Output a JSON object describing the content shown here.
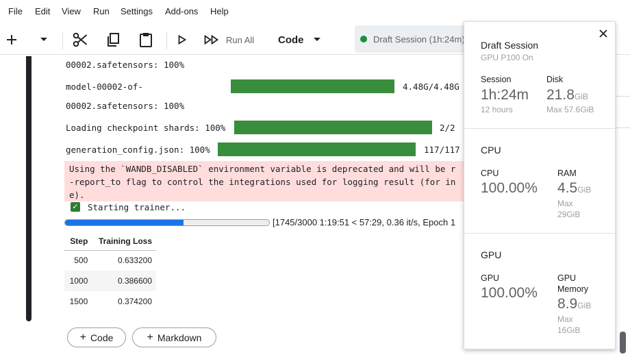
{
  "menu": [
    "File",
    "Edit",
    "View",
    "Run",
    "Settings",
    "Add-ons",
    "Help"
  ],
  "toolbar": {
    "run_all_label": "Run All",
    "cell_type": "Code",
    "icons": [
      "plus-icon",
      "chevron-down-icon",
      "scissors-icon",
      "copy-icon",
      "clipboard-icon",
      "play-icon",
      "fast-forward-icon"
    ]
  },
  "session_pill": {
    "label": "Draft Session (1h:24m)",
    "status_color": "#1e8e3e"
  },
  "output": {
    "line1": "00002.safetensors: 100%",
    "model_label": "model-00002-of-",
    "model_size": "4.48G/4.48G",
    "line3": "00002.safetensors: 100%",
    "checkpoint_label": "Loading checkpoint shards: 100%",
    "checkpoint_count": "2/2",
    "genconfig_label": "generation_config.json: 100%",
    "genconfig_count": "117/117",
    "warning_lines": [
      "Using the `WANDB_DISABLED` environment variable is deprecated and will be r",
      "-report_to flag to control the integrations used for logging result (for in",
      "e)."
    ],
    "trainer_status": "Starting trainer...",
    "progress_fraction": 0.582,
    "progress_text": "[1745/3000 1:19:51 < 57:29, 0.36 it/s, Epoch 1",
    "bar_color": "#388e3c",
    "progress_color": "#1a73e8"
  },
  "loss_table": {
    "headers": [
      "Step",
      "Training Loss"
    ],
    "rows": [
      [
        "500",
        "0.633200"
      ],
      [
        "1000",
        "0.386600"
      ],
      [
        "1500",
        "0.374200"
      ]
    ]
  },
  "add_buttons": {
    "code": "Code",
    "markdown": "Markdown"
  },
  "panel": {
    "title": "Draft Session",
    "subtitle": "GPU P100 On",
    "session_label": "Session",
    "session_value": "1h:24m",
    "session_max": "12 hours",
    "disk_label": "Disk",
    "disk_value": "21.8",
    "disk_unit": "GiB",
    "disk_max": "Max 57.6GiB",
    "cpu_section": "CPU",
    "cpu_label": "CPU",
    "cpu_value": "100.00%",
    "ram_label": "RAM",
    "ram_value": "4.5",
    "ram_unit": "GiB",
    "ram_max_1": "Max",
    "ram_max_2": "29GiB",
    "gpu_section": "GPU",
    "gpu_label": "GPU",
    "gpu_value": "100.00%",
    "gpumem_label_1": "GPU",
    "gpumem_label_2": "Memory",
    "gpumem_value": "8.9",
    "gpumem_unit": "GiB",
    "gpumem_max_1": "Max",
    "gpumem_max_2": "16GiB"
  }
}
